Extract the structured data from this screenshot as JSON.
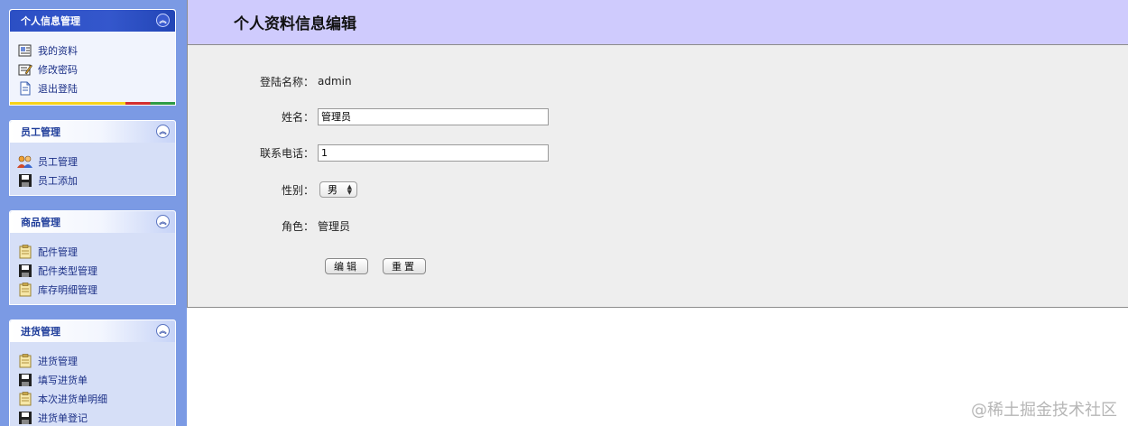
{
  "sidebar": {
    "panels": [
      {
        "title": "个人信息管理",
        "items": [
          {
            "label": "我的资料",
            "icon": "profile-icon"
          },
          {
            "label": "修改密码",
            "icon": "edit-icon"
          },
          {
            "label": "退出登陆",
            "icon": "document-icon"
          }
        ]
      },
      {
        "title": "员工管理",
        "items": [
          {
            "label": "员工管理",
            "icon": "users-icon"
          },
          {
            "label": "员工添加",
            "icon": "floppy-disk-icon"
          }
        ]
      },
      {
        "title": "商品管理",
        "items": [
          {
            "label": "配件管理",
            "icon": "clipboard-icon"
          },
          {
            "label": "配件类型管理",
            "icon": "floppy-disk-icon"
          },
          {
            "label": "库存明细管理",
            "icon": "clipboard-icon"
          }
        ]
      },
      {
        "title": "进货管理",
        "items": [
          {
            "label": "进货管理",
            "icon": "clipboard-icon"
          },
          {
            "label": "填写进货单",
            "icon": "floppy-disk-icon"
          },
          {
            "label": "本次进货单明细",
            "icon": "clipboard-icon"
          },
          {
            "label": "进货单登记",
            "icon": "floppy-disk-icon"
          }
        ]
      }
    ]
  },
  "main": {
    "title": "个人资料信息编辑",
    "form": {
      "login_label": "登陆名称：",
      "login_value": "admin",
      "name_label": "姓名：",
      "name_value": "管理员",
      "phone_label": "联系电话：",
      "phone_value": "1",
      "gender_label": "性别：",
      "gender_value": "男",
      "role_label": "角色：",
      "role_value": "管理员",
      "edit_button": "编辑",
      "reset_button": "重置"
    }
  },
  "watermark": "@稀土掘金技术社区",
  "colors": {
    "sidebar_bg": "#7b9ae4",
    "title_bar_bg": "#cfcbfd",
    "active_panel_header": "#2c4fc4",
    "content_bg": "#eeeeee"
  }
}
